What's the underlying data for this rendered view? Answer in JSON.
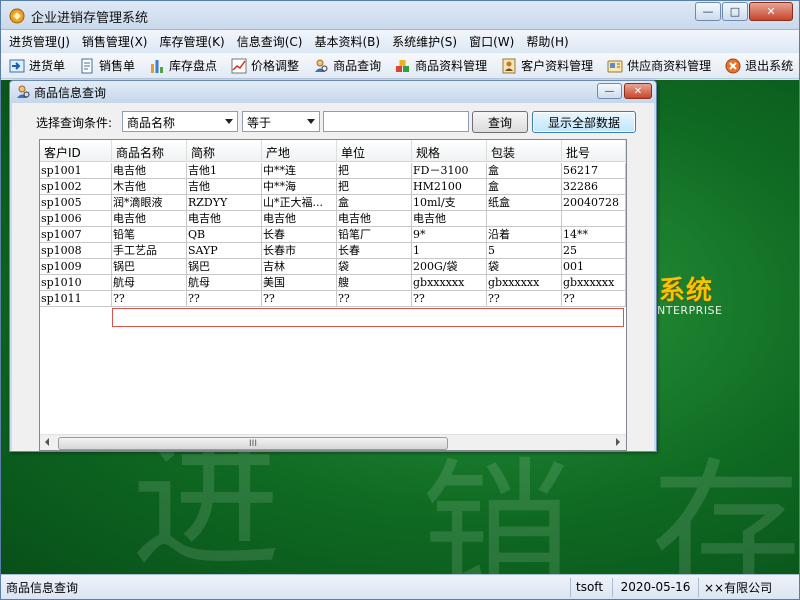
{
  "app": {
    "title": "企业进销存管理系统",
    "window_buttons": {
      "minimize": "—",
      "maximize": "□",
      "close": "✕"
    }
  },
  "menu": [
    {
      "label": "进货管理(J)"
    },
    {
      "label": "销售管理(X)"
    },
    {
      "label": "库存管理(K)"
    },
    {
      "label": "信息查询(C)"
    },
    {
      "label": "基本资料(B)"
    },
    {
      "label": "系统维护(S)"
    },
    {
      "label": "窗口(W)"
    },
    {
      "label": "帮助(H)"
    }
  ],
  "toolbar": [
    {
      "label": "进货单",
      "icon": "arrow-in-icon"
    },
    {
      "label": "销售单",
      "icon": "document-icon"
    },
    {
      "label": "库存盘点",
      "icon": "chart-icon"
    },
    {
      "label": "价格调整",
      "icon": "trend-icon"
    },
    {
      "label": "商品查询",
      "icon": "search-person-icon"
    },
    {
      "label": "商品资料管理",
      "icon": "blocks-icon"
    },
    {
      "label": "客户资料管理",
      "icon": "customer-icon"
    },
    {
      "label": "供应商资料管理",
      "icon": "supplier-icon"
    },
    {
      "label": "退出系统",
      "icon": "exit-icon"
    }
  ],
  "branding": {
    "title": "系统",
    "subtitle": "NTERPRISE"
  },
  "query_window": {
    "title": "商品信息查询",
    "buttons": {
      "minimize": "—",
      "close": "✕"
    },
    "condition_label": "选择查询条件:",
    "field_select": {
      "value": "商品名称"
    },
    "operator_select": {
      "value": "等于"
    },
    "query_input": {
      "value": ""
    },
    "query_button": "查询",
    "show_all_button": "显示全部数据",
    "columns": [
      "客户ID",
      "商品名称",
      "简称",
      "产地",
      "单位",
      "规格",
      "包装",
      "批号"
    ],
    "rows": [
      [
        "sp1001",
        "电吉他",
        "吉他1",
        "中**连",
        "把",
        "FD－3100",
        "盒",
        "56217"
      ],
      [
        "sp1002",
        "木吉他",
        "吉他",
        "中**海",
        "把",
        "HM2100",
        "盒",
        "32286"
      ],
      [
        "sp1005",
        "润*滴眼液",
        "RZDYY",
        "山*正大福...",
        "盒",
        "10ml/支",
        "纸盒",
        "20040728"
      ],
      [
        "sp1006",
        "电吉他",
        "电吉他",
        "电吉他",
        "电吉他",
        "电吉他",
        "",
        ""
      ],
      [
        "sp1007",
        "铅笔",
        "QB",
        "长春",
        "铅笔厂",
        "9*",
        "沿着",
        "14**"
      ],
      [
        "sp1008",
        "手工艺品",
        "SAYP",
        "长春市",
        "长春",
        "1",
        "5",
        "25"
      ],
      [
        "sp1009",
        "锅巴",
        "锅巴",
        "吉林",
        "袋",
        "200G/袋",
        "袋",
        "001"
      ],
      [
        "sp1010",
        "航母",
        "航母",
        "美国",
        "艘",
        "gbxxxxxx",
        "gbxxxxxx",
        "gbxxxxxx"
      ],
      [
        "sp1011",
        "??",
        "??",
        "??",
        "??",
        "??",
        "??",
        "??"
      ]
    ],
    "scroll_grip": "III"
  },
  "status": {
    "left": "商品信息查询",
    "user": "tsoft",
    "date": "2020-05-16",
    "company": "××有限公司"
  }
}
